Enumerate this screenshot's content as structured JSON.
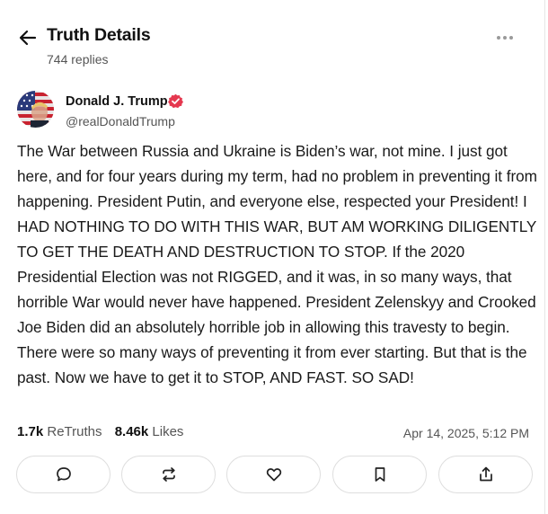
{
  "header": {
    "title": "Truth Details",
    "replies": "744 replies"
  },
  "author": {
    "name": "Donald J. Trump",
    "handle": "@realDonaldTrump",
    "verified": true
  },
  "post": {
    "text": "The War between Russia and Ukraine is Biden’s war, not mine. I just got here, and for four years during my term, had no problem in preventing it from happening. President Putin, and everyone else, respected your President! I HAD NOTHING TO DO WITH THIS WAR, BUT AM WORKING DILIGENTLY TO GET THE DEATH AND DESTRUCTION TO STOP. If the 2020 Presidential Election was not RIGGED, and it was, in so many ways, that horrible War would never have happened. President Zelenskyy and Crooked Joe Biden did an absolutely horrible job in allowing this travesty to begin. There were so many ways of preventing it from ever starting. But that is the past. Now we have to get it to STOP, AND FAST. SO SAD!",
    "retruths_count": "1.7k",
    "retruths_label": "ReTruths",
    "likes_count": "8.46k",
    "likes_label": "Likes",
    "timestamp": "Apr 14, 2025, 5:12 PM"
  },
  "actions": [
    {
      "name": "reply",
      "icon": "speech-bubble-icon"
    },
    {
      "name": "retruth",
      "icon": "repost-arrows-icon"
    },
    {
      "name": "like",
      "icon": "heart-icon"
    },
    {
      "name": "bookmark",
      "icon": "bookmark-icon"
    },
    {
      "name": "share",
      "icon": "share-upload-icon"
    }
  ],
  "colors": {
    "verified_badge": "#e5384f",
    "text": "#111111",
    "muted": "#555555",
    "border": "#dedede"
  }
}
